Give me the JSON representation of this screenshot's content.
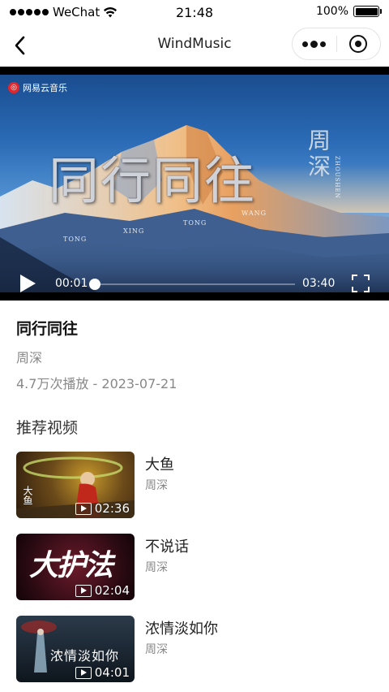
{
  "status_bar": {
    "carrier": "WeChat",
    "time": "21:48",
    "battery_percent": "100%",
    "battery_level": 1.0
  },
  "nav": {
    "title": "WindMusic"
  },
  "video": {
    "provider_logo": "网易云音乐",
    "art_title": "同行同往",
    "art_artist": "周深",
    "art_pinyin_1": "TONG",
    "art_pinyin_2": "XING",
    "art_pinyin_3": "TONG",
    "art_pinyin_4": "WANG",
    "art_pinyin_artist": "ZHOUSHEN",
    "current_time": "00:01",
    "total_time": "03:40",
    "progress": 0.005
  },
  "info": {
    "title": "同行同往",
    "artist": "周深",
    "meta": "4.7万次播放 - 2023-07-21"
  },
  "recommend": {
    "section_title": "推荐视频",
    "items": [
      {
        "title": "大鱼",
        "artist": "周深",
        "duration": "02:36",
        "art": "大鱼"
      },
      {
        "title": "不说话",
        "artist": "周深",
        "duration": "02:04",
        "art": "大护法"
      },
      {
        "title": "浓情淡如你",
        "artist": "周深",
        "duration": "04:01",
        "art": "浓情淡如你"
      }
    ]
  },
  "icons": {
    "back": "chevron-left-icon",
    "more": "more-dots-icon",
    "close": "target-close-icon",
    "play": "play-icon",
    "fullscreen": "fullscreen-icon",
    "wifi": "wifi-icon",
    "battery": "battery-icon"
  }
}
